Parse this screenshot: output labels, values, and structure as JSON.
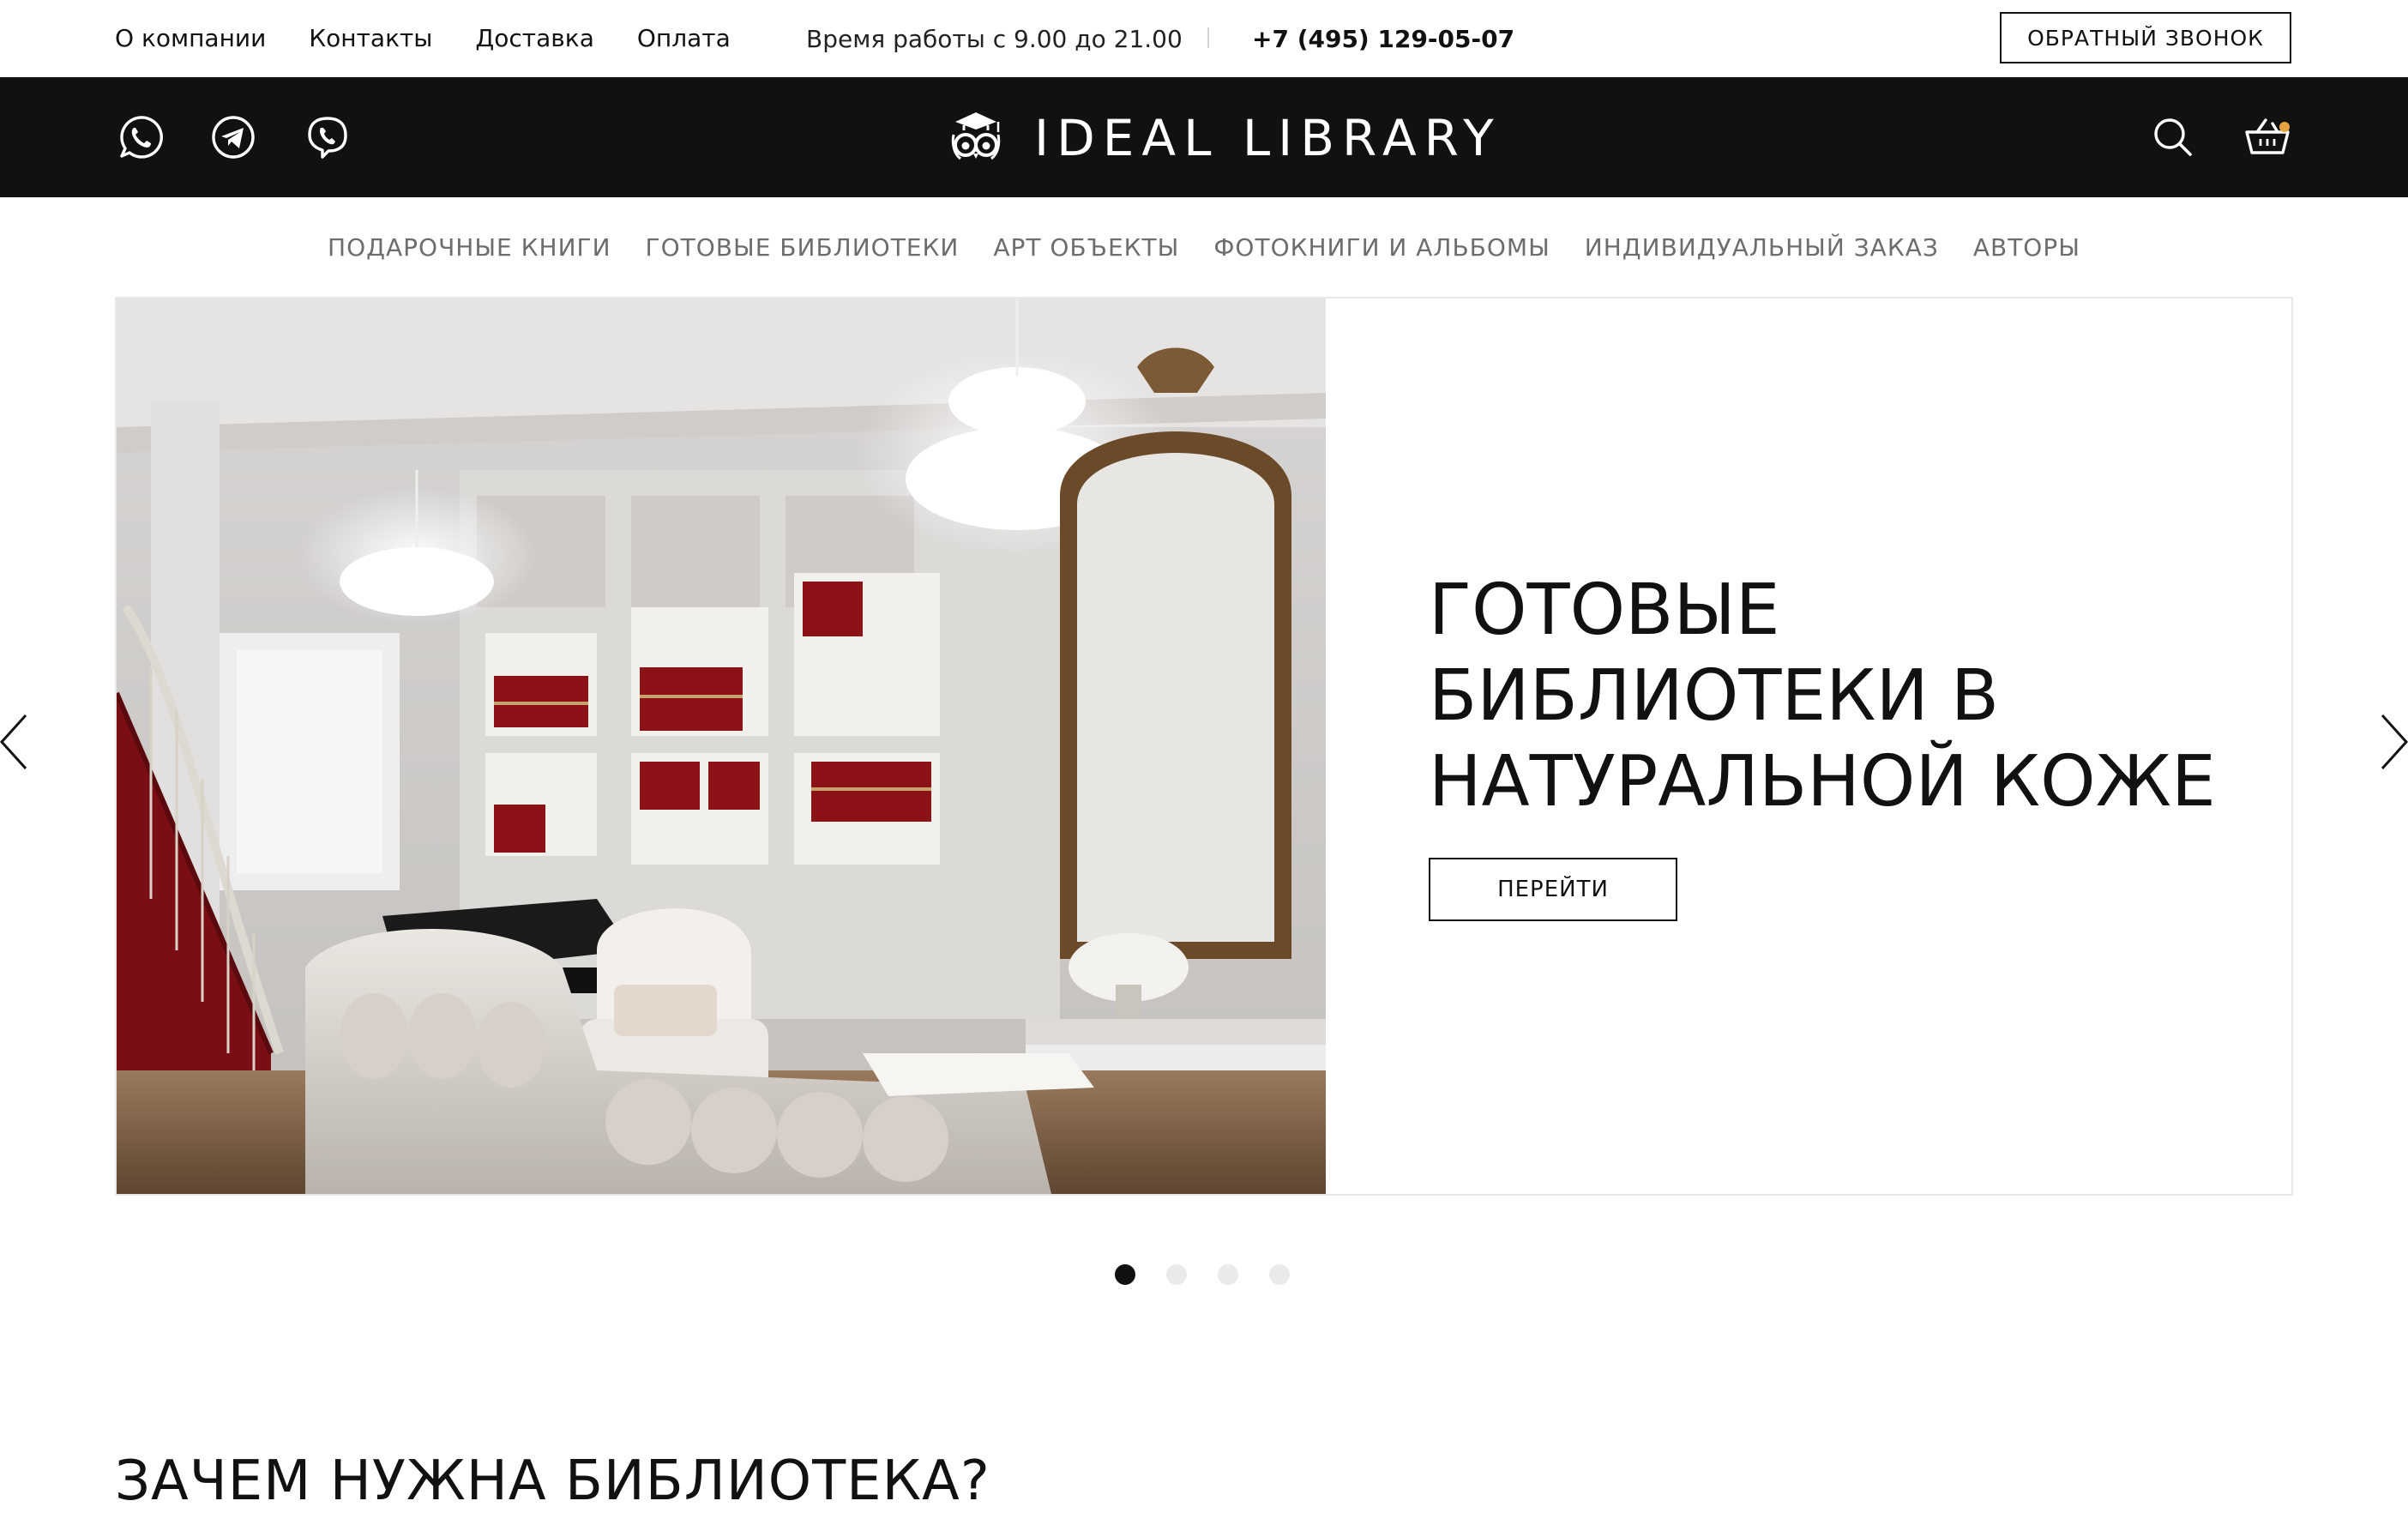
{
  "topbar": {
    "links": [
      "О компании",
      "Контакты",
      "Доставка",
      "Оплата"
    ],
    "hours": "Время работы с 9.00 до 21.00",
    "phone": "+7 (495) 129-05-07",
    "callback_label": "ОБРАТНЫЙ ЗВОНОК"
  },
  "header": {
    "logo_text": "IDEAL LIBRARY",
    "social_icons": [
      "whatsapp-icon",
      "telegram-icon",
      "viber-icon"
    ],
    "background": "#111111",
    "cart_badge_color": "#e8a33c"
  },
  "catnav": {
    "items": [
      "ПОДАРОЧНЫЕ КНИГИ",
      "ГОТОВЫЕ БИБЛИОТЕКИ",
      "АРТ ОБЪЕКТЫ",
      "ФОТОКНИГИ И АЛЬБОМЫ",
      "ИНДИВИДУАЛЬНЫЙ ЗАКАЗ",
      "АВТОРЫ"
    ]
  },
  "hero": {
    "title_lines": [
      "ГОТОВЫЕ",
      "БИБЛИОТЕКИ В",
      "НАТУРАЛЬНОЙ КОЖЕ"
    ],
    "button_label": "ПЕРЕЙТИ",
    "slide_count": 4,
    "active_slide": 1
  },
  "section": {
    "title": "ЗАЧЕМ НУЖНА БИБЛИОТЕКА?"
  }
}
